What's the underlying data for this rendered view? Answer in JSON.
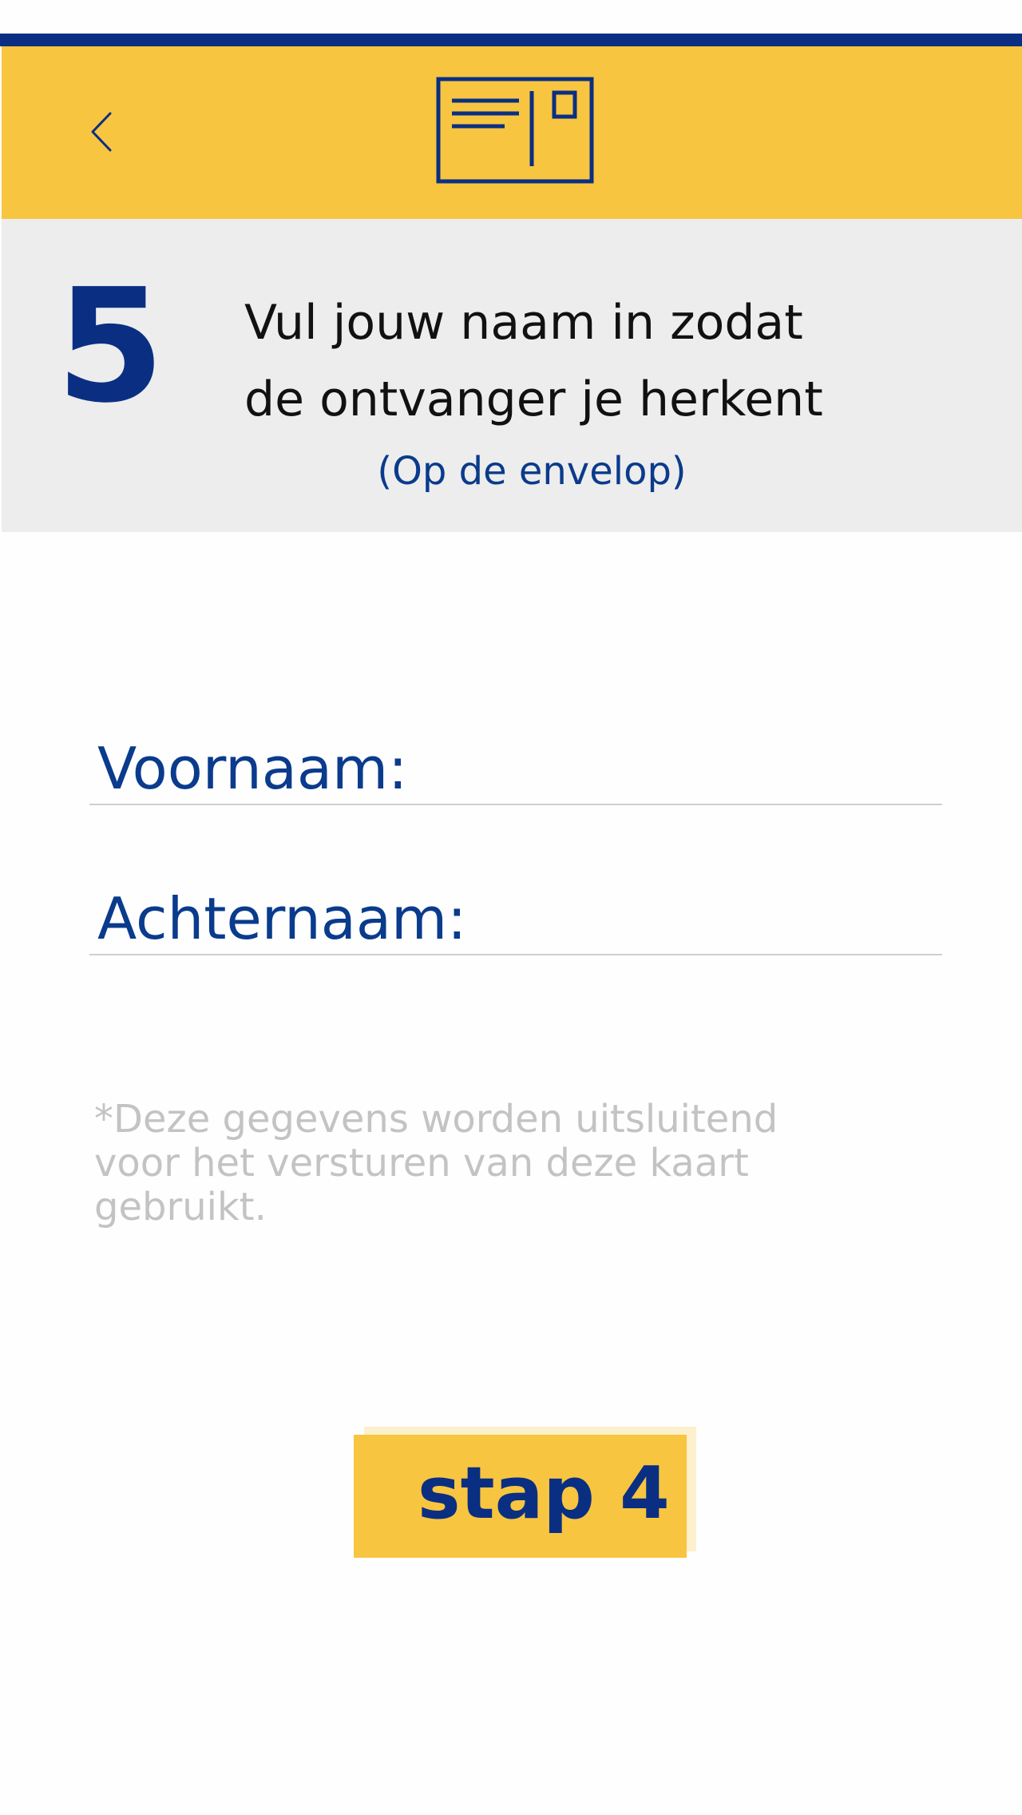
{
  "header": {
    "back_icon": "chevron-left-icon",
    "logo_icon": "postcard-icon"
  },
  "step": {
    "number": "5",
    "title_line1": "Vul jouw naam in zodat",
    "title_line2": "de ontvanger je herkent",
    "subtitle": "(Op de envelop)"
  },
  "form": {
    "first_name_label": "Voornaam:",
    "first_name_value": "",
    "last_name_label": "Achternaam:",
    "last_name_value": ""
  },
  "disclaimer": {
    "line1": "*Deze gegevens worden uitsluitend",
    "line2": "voor het versturen van deze kaart",
    "line3": "gebruikt."
  },
  "next_button": {
    "label": "stap 4"
  },
  "colors": {
    "brand_blue": "#0a2f82",
    "brand_yellow": "#f8c540",
    "panel_gray": "#ededed",
    "disclaimer_gray": "#c3c3c3"
  }
}
